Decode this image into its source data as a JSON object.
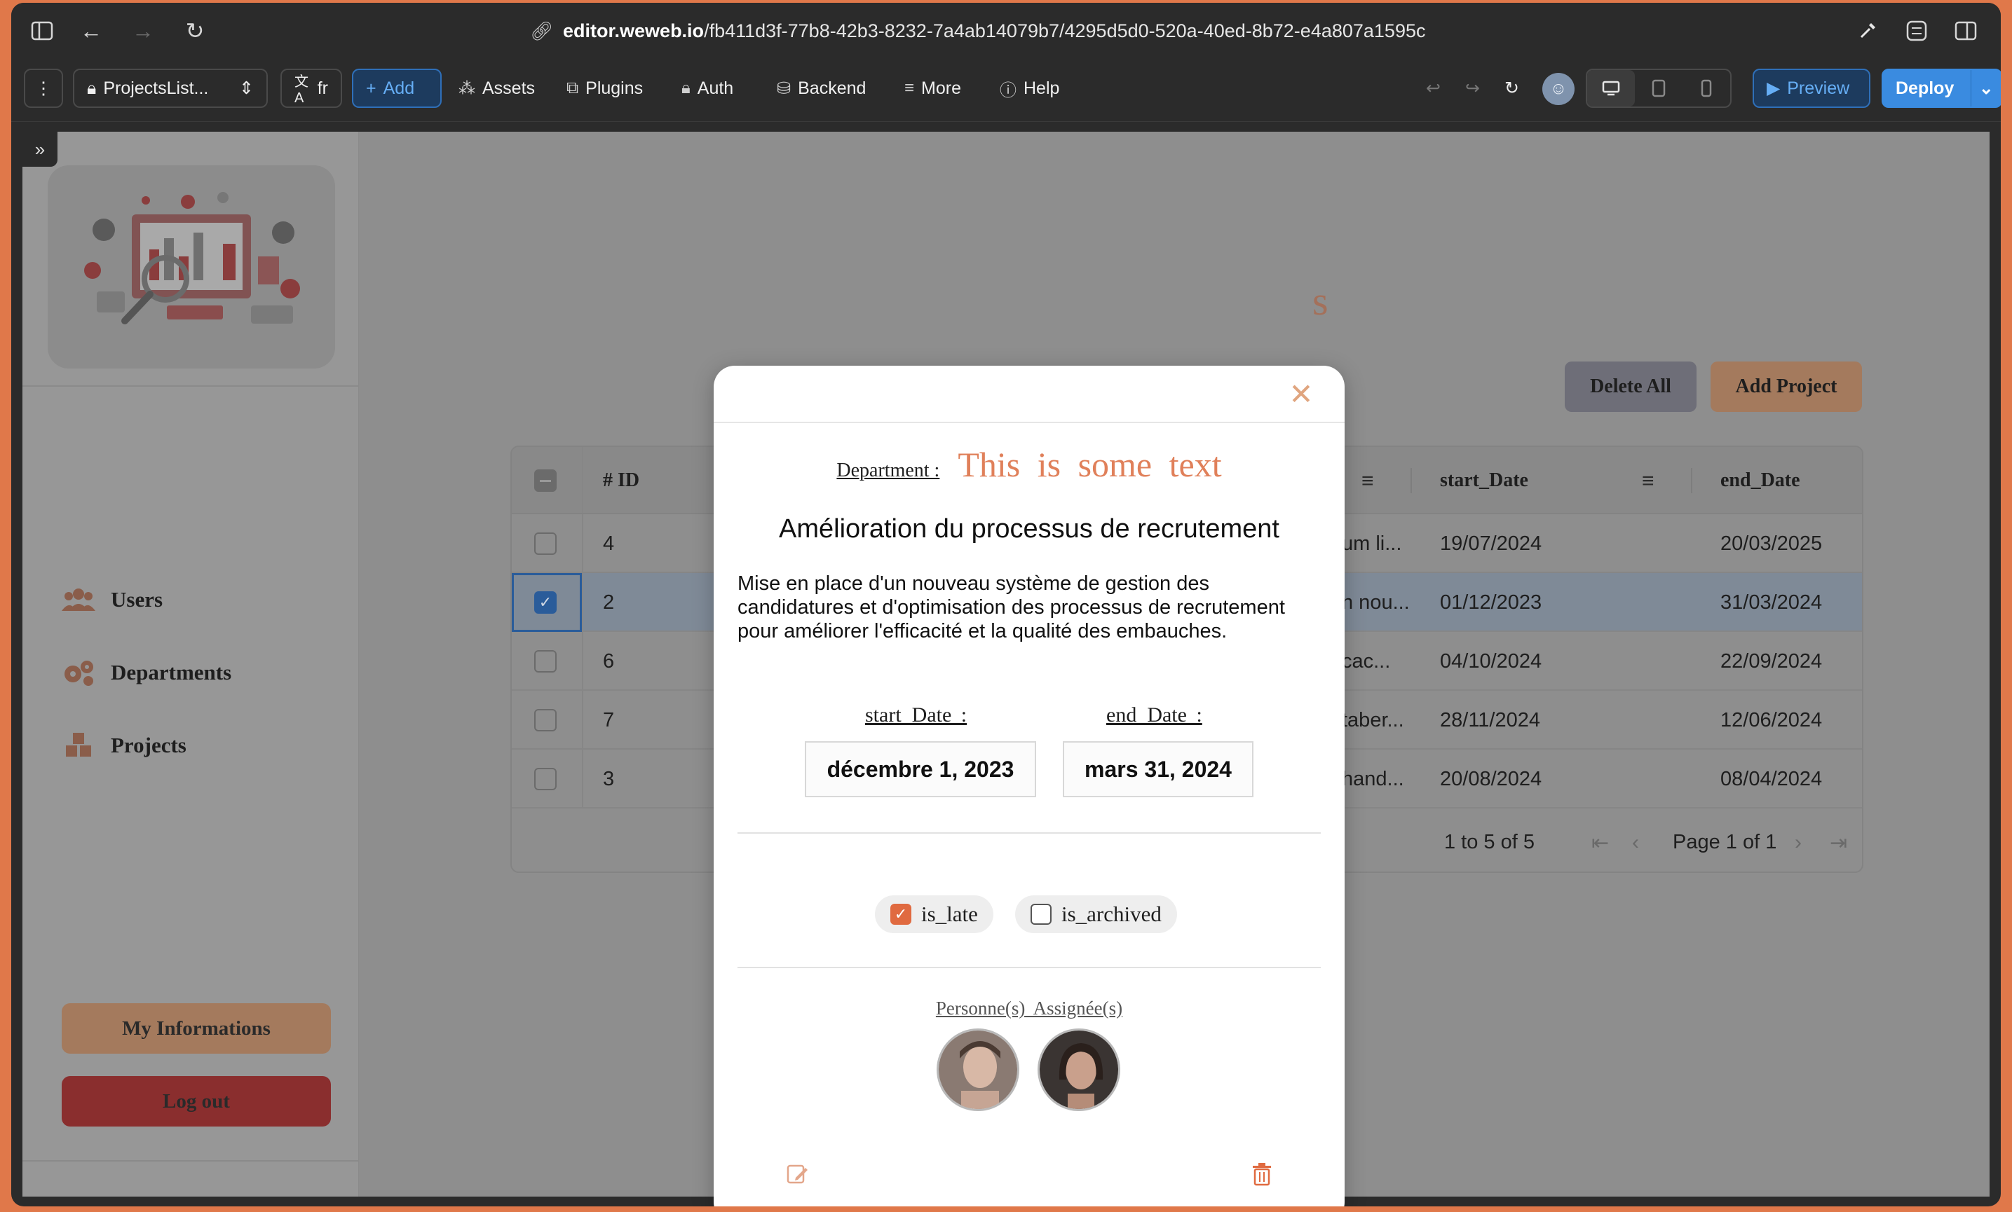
{
  "browser": {
    "url_host": "editor.weweb.io",
    "url_path": "/fb411d3f-77b8-42b3-8232-7a4ab14079b7/4295d5d0-520a-40ed-8b72-e4a807a1595c"
  },
  "toolbar": {
    "page_selector": "ProjectsList...",
    "language": "fr",
    "add_label": "Add",
    "assets_label": "Assets",
    "plugins_label": "Plugins",
    "auth_label": "Auth",
    "backend_label": "Backend",
    "more_label": "More",
    "help_label": "Help",
    "preview_label": "Preview",
    "deploy_label": "Deploy"
  },
  "sidebar": {
    "items": [
      {
        "label": "Users",
        "icon": "users-icon"
      },
      {
        "label": "Departments",
        "icon": "gears-icon"
      },
      {
        "label": "Projects",
        "icon": "cubes-icon"
      }
    ],
    "my_info_label": "My Informations",
    "logout_label": "Log out"
  },
  "main": {
    "title_fragment": "s",
    "delete_all_label": "Delete All",
    "add_project_label": "Add Project"
  },
  "table": {
    "headers": {
      "id": "# ID",
      "start": "start_Date",
      "end": "end_Date"
    },
    "rows": [
      {
        "id": "4",
        "desc": "um li...",
        "start": "19/07/2024",
        "end": "20/03/2025",
        "checked": false
      },
      {
        "id": "2",
        "desc": "n nou...",
        "start": "01/12/2023",
        "end": "31/03/2024",
        "checked": true
      },
      {
        "id": "6",
        "desc": "cac...",
        "start": "04/10/2024",
        "end": "22/09/2024",
        "checked": false
      },
      {
        "id": "7",
        "desc": "taber...",
        "start": "28/11/2024",
        "end": "12/06/2024",
        "checked": false
      },
      {
        "id": "3",
        "desc": "hand...",
        "start": "20/08/2024",
        "end": "08/04/2024",
        "checked": false
      }
    ],
    "range_text": "1 to 5 of 5",
    "page_text": "Page 1 of 1"
  },
  "modal": {
    "department_label": "Department :",
    "department_value": "This is some text",
    "project_title": "Amélioration du processus de recrutement",
    "project_description": "Mise en place d'un nouveau système de gestion des candidatures et d'optimisation des processus de recrutement pour améliorer l'efficacité et la qualité des embauches.",
    "start_label": "start_Date :",
    "end_label": "end_Date :",
    "start_value": "décembre 1, 2023",
    "end_value": "mars 31, 2024",
    "is_late_label": "is_late",
    "is_archived_label": "is_archived",
    "is_late_checked": true,
    "is_archived_checked": false,
    "assigned_label": "Personne(s) Assignée(s)"
  },
  "colors": {
    "accent": "#e0805a",
    "deploy": "#3a8be0",
    "checkbox_checked": "#e06a40",
    "logout": "#8a2e2e",
    "my_info": "#a47a5d"
  }
}
